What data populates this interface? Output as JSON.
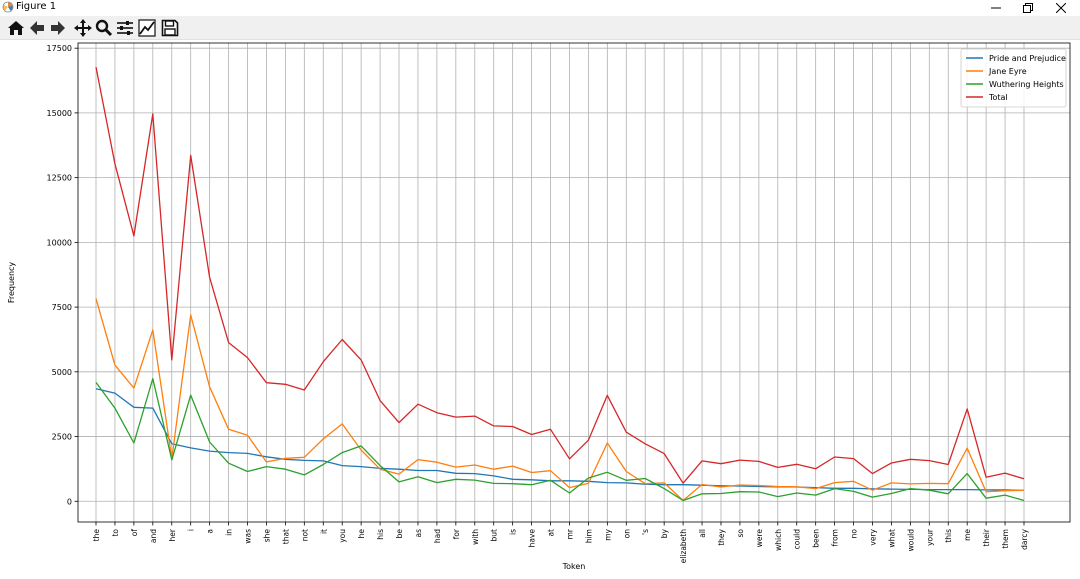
{
  "window": {
    "title": "Figure 1"
  },
  "toolbar": {
    "tools": [
      "home-icon",
      "back-arrow-icon",
      "forward-arrow-icon",
      "pan-icon",
      "zoom-icon",
      "subplots-icon",
      "customize-icon",
      "save-icon"
    ]
  },
  "colors": {
    "pride": "#1f77b4",
    "jane": "#ff7f0e",
    "wuthering": "#2ca02c",
    "total": "#d62728",
    "grid": "#b0b0b0"
  },
  "chart_data": {
    "type": "line",
    "title": "",
    "xlabel": "Token",
    "ylabel": "Frequency",
    "ylim": [
      -800,
      17700
    ],
    "yticks": [
      0,
      2500,
      5000,
      7500,
      10000,
      12500,
      15000,
      17500
    ],
    "ytick_labels": [
      "0",
      "2500",
      "5000",
      "7500",
      "10000",
      "12500",
      "15000",
      "17500"
    ],
    "grid": true,
    "legend_position": "top-right",
    "categories": [
      "the",
      "to",
      "of",
      "and",
      "her",
      "i",
      "a",
      "in",
      "was",
      "she",
      "that",
      "not",
      "it",
      "you",
      "he",
      "his",
      "be",
      "as",
      "had",
      "for",
      "with",
      "but",
      "is",
      "have",
      "at",
      "mr",
      "him",
      "my",
      "on",
      "'s",
      "by",
      "elizabeth",
      "all",
      "they",
      "so",
      "were",
      "which",
      "could",
      "been",
      "from",
      "no",
      "very",
      "what",
      "would",
      "your",
      "this",
      "me",
      "their",
      "them",
      "darcy"
    ],
    "series": [
      {
        "name": "Pride and Prejudice",
        "color": "#1f77b4",
        "values": [
          4350,
          4180,
          3630,
          3600,
          2220,
          2060,
          1940,
          1880,
          1850,
          1720,
          1620,
          1580,
          1560,
          1380,
          1340,
          1270,
          1240,
          1190,
          1190,
          1080,
          1070,
          980,
          850,
          830,
          790,
          790,
          770,
          720,
          710,
          660,
          640,
          640,
          620,
          600,
          590,
          570,
          560,
          550,
          530,
          500,
          500,
          480,
          470,
          460,
          450,
          450,
          450,
          440,
          440,
          420
        ]
      },
      {
        "name": "Jane Eyre",
        "color": "#ff7f0e",
        "values": [
          7830,
          5260,
          4370,
          6620,
          1640,
          7200,
          4420,
          2780,
          2550,
          1520,
          1660,
          1700,
          2410,
          2990,
          1980,
          1240,
          1050,
          1610,
          1510,
          1320,
          1400,
          1240,
          1360,
          1110,
          1180,
          530,
          690,
          2250,
          1150,
          680,
          710,
          30,
          650,
          550,
          630,
          610,
          570,
          560,
          490,
          720,
          770,
          430,
          710,
          670,
          690,
          680,
          2050,
          370,
          410,
          420
        ]
      },
      {
        "name": "Wuthering Heights",
        "color": "#2ca02c",
        "values": [
          4590,
          3600,
          2250,
          4740,
          1600,
          4100,
          2290,
          1470,
          1150,
          1340,
          1240,
          1020,
          1420,
          1880,
          2140,
          1380,
          750,
          950,
          720,
          850,
          820,
          690,
          680,
          640,
          810,
          320,
          900,
          1120,
          810,
          880,
          490,
          30,
          290,
          300,
          370,
          360,
          180,
          320,
          240,
          490,
          380,
          160,
          300,
          490,
          430,
          290,
          1070,
          120,
          240,
          30
        ]
      },
      {
        "name": "Total",
        "color": "#d62728",
        "values": [
          16770,
          13040,
          10250,
          14960,
          5460,
          13360,
          8650,
          6130,
          5550,
          4580,
          4520,
          4300,
          5390,
          6250,
          5460,
          3890,
          3040,
          3750,
          3420,
          3250,
          3290,
          2910,
          2890,
          2580,
          2780,
          1640,
          2360,
          4090,
          2670,
          2220,
          1840,
          700,
          1560,
          1450,
          1590,
          1540,
          1310,
          1430,
          1260,
          1710,
          1650,
          1070,
          1480,
          1620,
          1570,
          1420,
          3570,
          930,
          1090,
          870
        ]
      }
    ]
  }
}
